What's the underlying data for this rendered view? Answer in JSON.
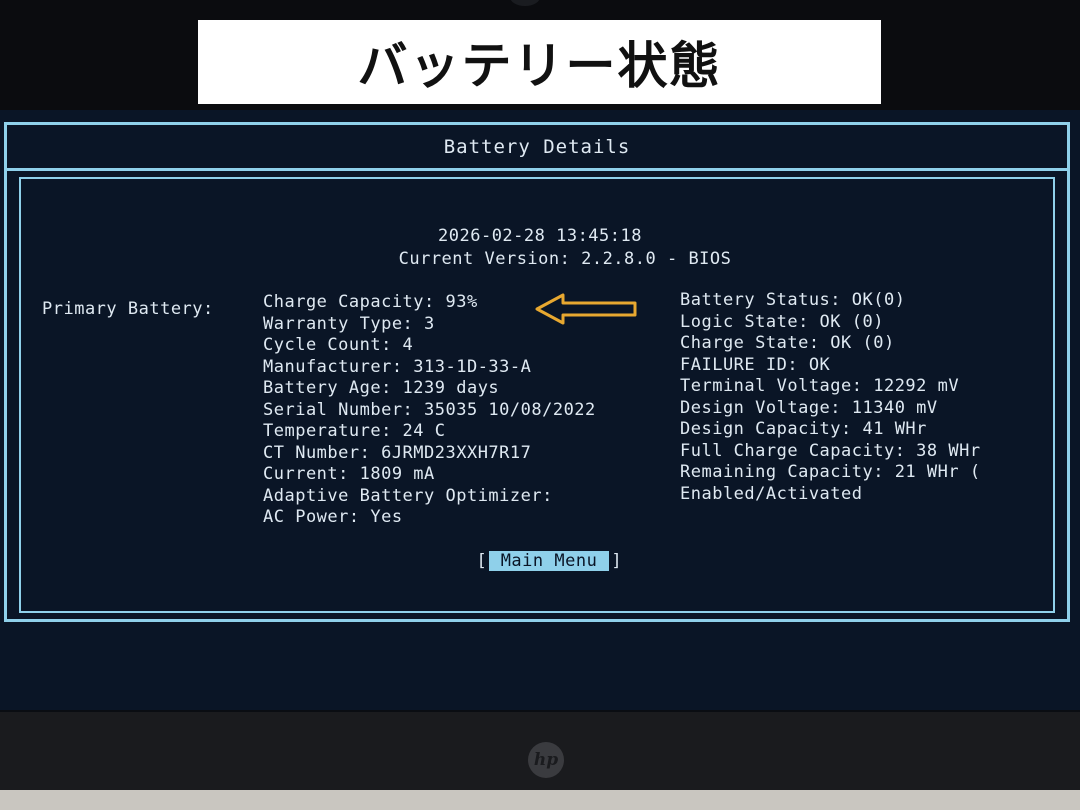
{
  "caption": "バッテリー状態",
  "window": {
    "title": "Battery Details"
  },
  "header": {
    "datetime": "2026-02-28 13:45:18",
    "version": "Current Version: 2.2.8.0 - BIOS"
  },
  "primary_label": "Primary Battery:",
  "left_fields": [
    "Charge Capacity: 93%",
    "Warranty Type: 3",
    "Cycle Count: 4",
    "Manufacturer: 313-1D-33-A",
    "Battery Age: 1239 days",
    "Serial Number: 35035 10/08/2022",
    "Temperature: 24 C",
    "CT Number: 6JRMD23XXH7R17",
    "Current: 1809 mA",
    "Adaptive Battery Optimizer:",
    "AC Power: Yes"
  ],
  "right_fields": [
    "Battery Status: OK(0)",
    "Logic State: OK (0)",
    "Charge State: OK (0)",
    "FAILURE ID: OK",
    "Terminal Voltage: 12292 mV",
    "Design Voltage: 11340 mV",
    "Design Capacity: 41 WHr",
    "Full Charge Capacity: 38 WHr",
    "Remaining Capacity: 21 WHr (",
    "Enabled/Activated"
  ],
  "main_menu": {
    "open": "[",
    "label": "Main Menu",
    "close": "]"
  },
  "brand": "hp",
  "colors": {
    "frame": "#8fd0ea",
    "text": "#dfe9f2",
    "background": "#0a1526",
    "arrow": "#e8a830"
  },
  "icons": {
    "arrow": "left-arrow-icon",
    "logo": "hp-logo-icon"
  }
}
